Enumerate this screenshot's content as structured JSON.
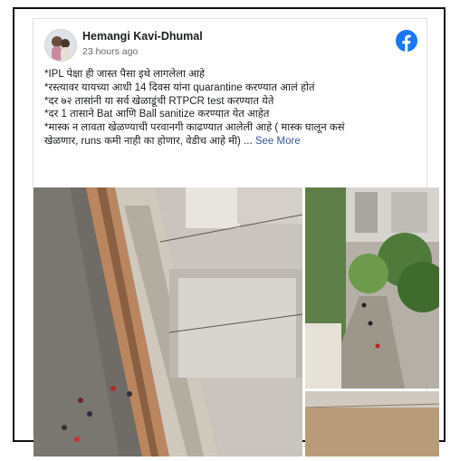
{
  "post": {
    "author": "Hemangi Kavi-Dhumal",
    "time": "23 hours ago",
    "lines": [
      "*IPL पेक्षा ही जास्त पैसा इथे लागलेला आहे",
      "*रस्त्यावर यायच्या आधी 14 दिवस यांना quarantine करण्यात आलं होतं",
      "*दर ७२ तासांनी या सर्व खेळाडूंची RTPCR test करण्यात येते",
      "*दर 1 तासाने Bat आणि Ball sanitize करण्यात येत आहेत",
      "*मास्क न लावता खेळण्याची परवानगी काढण्यात आलेली आहे ( मास्क घालून कसं",
      "खेळणार, runs कमी नाही का होणार, वेडीच आहे मी)"
    ],
    "ellipsis": " ... ",
    "see_more": "See More"
  },
  "photos": [
    {
      "name": "photo-rooftop-street",
      "icon": "photo"
    },
    {
      "name": "photo-tree-lined-street",
      "icon": "photo"
    },
    {
      "name": "photo-open-ground",
      "icon": "photo"
    }
  ],
  "colors": {
    "link": "#385898",
    "facebook_blue": "#1877f2",
    "text": "#1c1e21",
    "muted": "#65676b"
  },
  "icons": {
    "logo": "facebook-logo-icon",
    "avatar": "user-avatar"
  }
}
